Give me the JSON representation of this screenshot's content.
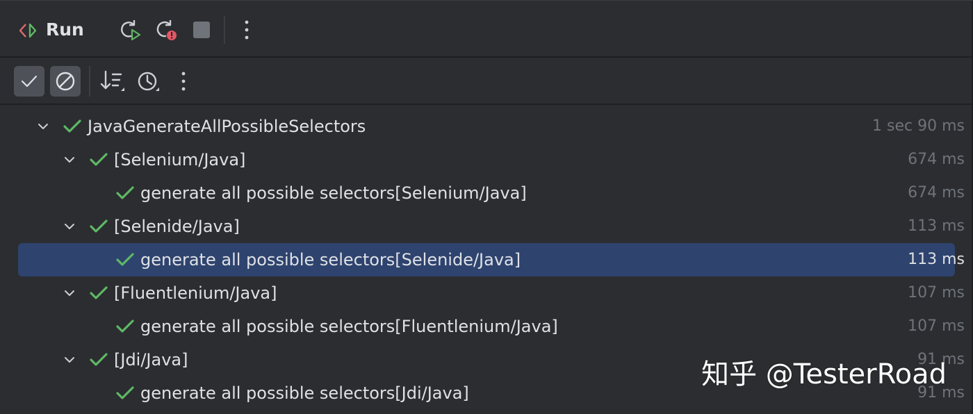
{
  "colors": {
    "background": "#2b2d30",
    "selection": "#2e436e",
    "success_green": "#5fb865",
    "muted_text": "#6f737a",
    "text": "#dfe1e5"
  },
  "header": {
    "title": "Run",
    "icons": [
      "run-panel-icon",
      "rerun-icon",
      "rerun-failed-icon",
      "stop-icon",
      "more-options-icon"
    ]
  },
  "toolbar": {
    "icons": [
      "show-passed-icon",
      "show-ignored-icon",
      "sort-icon",
      "history-icon",
      "more-options-icon"
    ]
  },
  "tree": {
    "rows": [
      {
        "label": "JavaGenerateAllPossibleSelectors",
        "time": "1 sec 90 ms",
        "level": 0,
        "expandable": true,
        "selected": false
      },
      {
        "label": "[Selenium/Java]",
        "time": "674 ms",
        "level": 1,
        "expandable": true,
        "selected": false
      },
      {
        "label": "generate all possible selectors[Selenium/Java]",
        "time": "674 ms",
        "level": 2,
        "expandable": false,
        "selected": false
      },
      {
        "label": "[Selenide/Java]",
        "time": "113 ms",
        "level": 1,
        "expandable": true,
        "selected": false
      },
      {
        "label": "generate all possible selectors[Selenide/Java]",
        "time": "113 ms",
        "level": 2,
        "expandable": false,
        "selected": true
      },
      {
        "label": "[Fluentlenium/Java]",
        "time": "107 ms",
        "level": 1,
        "expandable": true,
        "selected": false
      },
      {
        "label": "generate all possible selectors[Fluentlenium/Java]",
        "time": "107 ms",
        "level": 2,
        "expandable": false,
        "selected": false
      },
      {
        "label": "[Jdi/Java]",
        "time": "91 ms",
        "level": 1,
        "expandable": true,
        "selected": false
      },
      {
        "label": "generate all possible selectors[Jdi/Java]",
        "time": "91 ms",
        "level": 2,
        "expandable": false,
        "selected": false
      }
    ]
  },
  "watermark": "知乎 @TesterRoad"
}
